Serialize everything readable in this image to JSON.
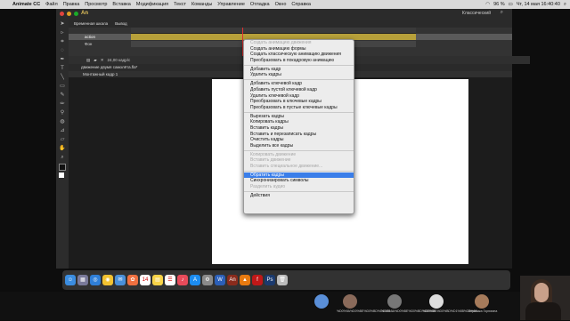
{
  "macmenu": {
    "app": "Animate CC",
    "items": [
      "Файл",
      "Правка",
      "Просмотр",
      "Вставка",
      "Модификация",
      "Текст",
      "Команды",
      "Управление",
      "Отладка",
      "Окно",
      "Справка"
    ],
    "battery": "96 %",
    "datetime": "Чт, 14 мая 16:40:40"
  },
  "app": {
    "logo": "An",
    "workspace": "Классический"
  },
  "timeline": {
    "tabs": [
      "Временная шкала",
      "Вывод"
    ],
    "layers": [
      {
        "name": "action",
        "selected": true
      },
      {
        "name": "Фон",
        "selected": false
      }
    ],
    "status": "24,00 кадр/с"
  },
  "document": {
    "tab": "движение двумя самолёта.fla*",
    "scene": "Монтажный кадр 1"
  },
  "context_menu": {
    "items": [
      {
        "label": "Создать анимацию движения",
        "disabled": true
      },
      {
        "label": "Создать анимацию формы",
        "disabled": false
      },
      {
        "label": "Создать классическую анимацию движения",
        "disabled": false
      },
      {
        "label": "Преобразовать в покадровую анимацию",
        "disabled": false
      },
      {
        "sep": true
      },
      {
        "label": "Добавить кадр",
        "disabled": false
      },
      {
        "label": "Удалить кадры",
        "disabled": false
      },
      {
        "sep": true
      },
      {
        "label": "Добавить ключевой кадр",
        "disabled": false
      },
      {
        "label": "Добавить пустой ключевой кадр",
        "disabled": false
      },
      {
        "label": "Удалить ключевой кадр",
        "disabled": false
      },
      {
        "label": "Преобразовать в ключевые кадры",
        "disabled": false
      },
      {
        "label": "Преобразовать в пустые ключевые кадры",
        "disabled": false
      },
      {
        "sep": true
      },
      {
        "label": "Вырезать кадры",
        "disabled": false
      },
      {
        "label": "Копировать кадры",
        "disabled": false
      },
      {
        "label": "Вставить кадры",
        "disabled": false
      },
      {
        "label": "Вставить и перезаписать кадры",
        "disabled": false
      },
      {
        "label": "Очистить кадры",
        "disabled": false
      },
      {
        "label": "Выделить все кадры",
        "disabled": false
      },
      {
        "sep": true
      },
      {
        "label": "Копировать движение",
        "disabled": true
      },
      {
        "label": "Вставить движение",
        "disabled": true
      },
      {
        "label": "Вставить специальное движение...",
        "disabled": true
      },
      {
        "sep": true
      },
      {
        "label": "Обратить кадры",
        "highlighted": true
      },
      {
        "label": "Синхронизировать символы",
        "disabled": false
      },
      {
        "label": "Разделить аудио",
        "disabled": true
      },
      {
        "sep": true
      },
      {
        "label": "Действия",
        "disabled": false
      }
    ]
  },
  "participants": [
    {
      "name": "%D0%9A%D0%BE%D0%BD%D1%81..."
    },
    {
      "name": "%D0%9A%D0%BE%D0%BD%D0%B9..."
    },
    {
      "name": "%D0%BE%D0%BD%D1%8B%D0%B0..."
    },
    {
      "name": "Вероника Горюхина"
    }
  ],
  "dock_icons": [
    "finder-icon",
    "launchpad-icon",
    "safari-icon",
    "chrome-icon",
    "mail-icon",
    "photos-icon",
    "calendar-icon",
    "notes-icon",
    "reminders-icon",
    "music-icon",
    "appstore-icon",
    "settings-icon",
    "word-icon",
    "animate-icon",
    "vlc-icon",
    "flash-icon",
    "photoshop-icon",
    "trash-icon"
  ]
}
